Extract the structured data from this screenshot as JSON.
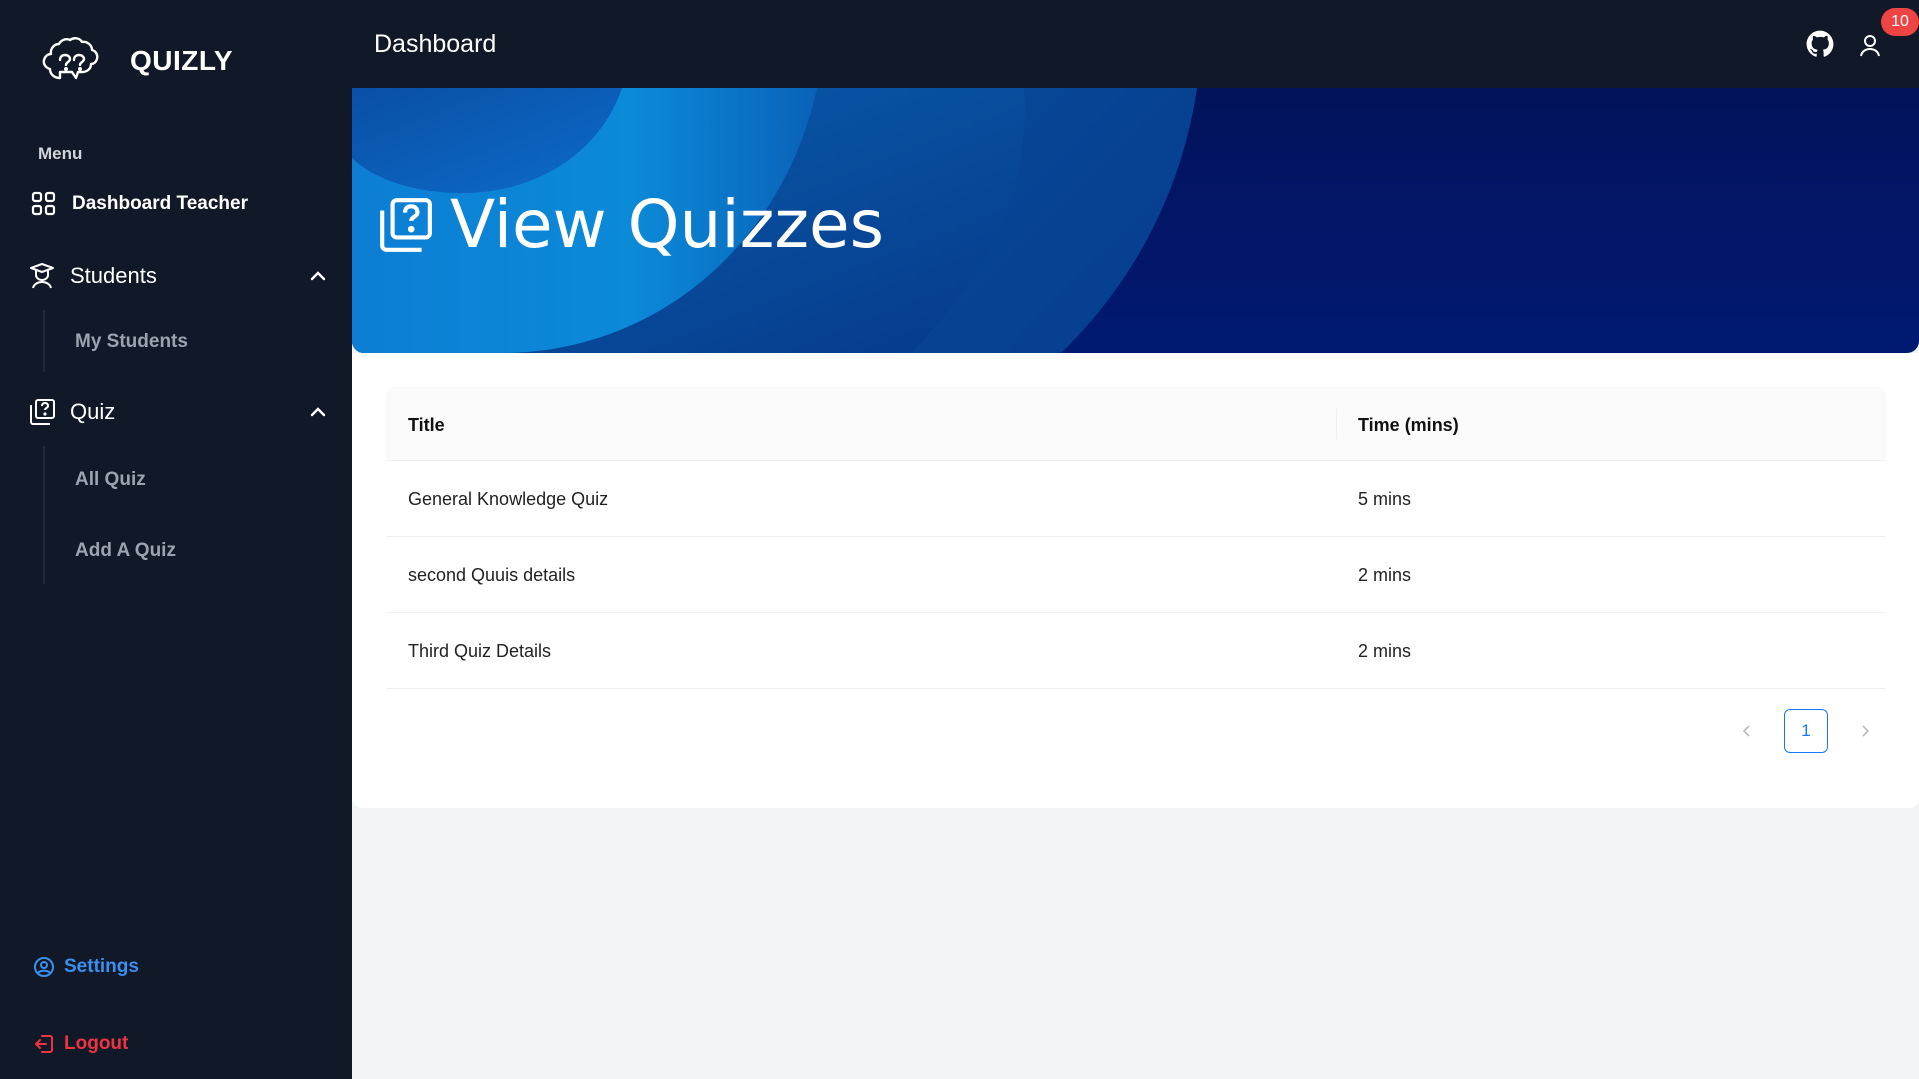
{
  "brand": {
    "name": "QUIZLY",
    "logo_icon": "brain-question-icon"
  },
  "sidebar": {
    "menu_label": "Menu",
    "dashboard": "Dashboard Teacher",
    "students": {
      "label": "Students",
      "items": [
        "My Students"
      ]
    },
    "quiz": {
      "label": "Quiz",
      "items": [
        "All Quiz",
        "Add A Quiz"
      ]
    },
    "settings": "Settings",
    "logout": "Logout"
  },
  "header": {
    "title": "Dashboard",
    "notification_count": "10"
  },
  "banner": {
    "title": "View Quizzes"
  },
  "table": {
    "columns": [
      "Title",
      "Time (mins)"
    ],
    "rows": [
      [
        "General Knowledge Quiz",
        "5 mins"
      ],
      [
        "second Quuis details",
        "2 mins"
      ],
      [
        "Third Quiz Details",
        "2 mins"
      ]
    ]
  },
  "pagination": {
    "current_page": "1"
  },
  "colors": {
    "sidebar_bg": "#111827",
    "accent_blue": "#3b8ff0",
    "logout_red": "#ef3340",
    "badge_red": "#ef4444",
    "banner_navy": "#02135a"
  }
}
